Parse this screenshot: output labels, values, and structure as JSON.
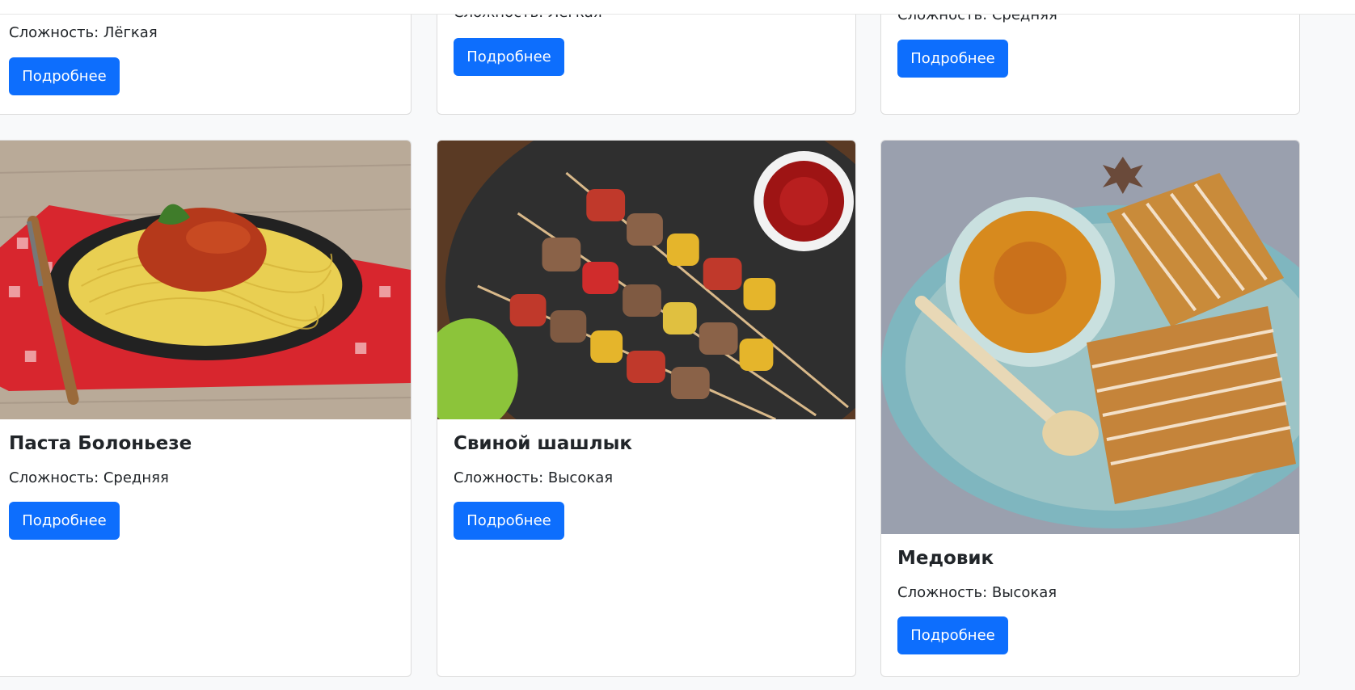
{
  "theme": {
    "accent": "#0d6efd",
    "background": "#f8f9fa",
    "card_border": "#dcdcdc"
  },
  "recipes_top": [
    {
      "difficulty": "Сложность: Лёгкая",
      "button": "Подробнее"
    },
    {
      "difficulty": "Сложность: Лёгкая",
      "button": "Подробнее"
    },
    {
      "difficulty": "Сложность: Средняя",
      "button": "Подробнее"
    }
  ],
  "recipes": [
    {
      "title": "Паста Болоньезе",
      "difficulty": "Сложность: Средняя",
      "button": "Подробнее",
      "image": "pasta-bolognese-photo"
    },
    {
      "title": "Свиной шашлык",
      "difficulty": "Сложность: Высокая",
      "button": "Подробнее",
      "image": "pork-kebab-photo"
    },
    {
      "title": "Медовик",
      "difficulty": "Сложность: Высокая",
      "button": "Подробнее",
      "image": "honey-cake-photo"
    }
  ]
}
